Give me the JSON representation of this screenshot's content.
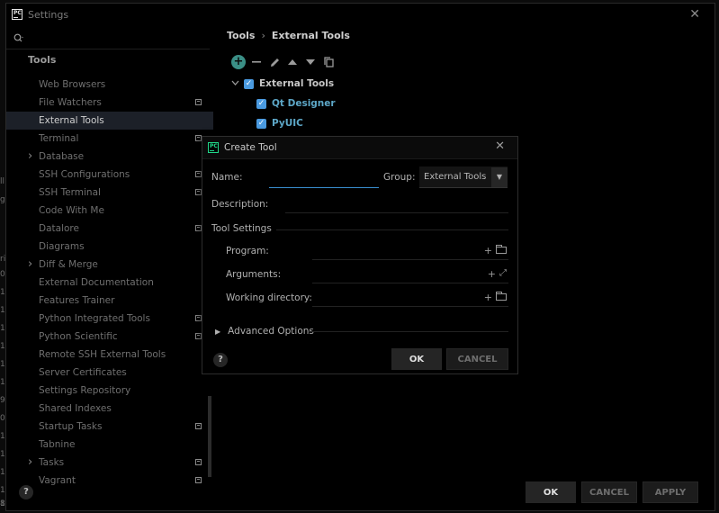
{
  "window": {
    "title": "Settings"
  },
  "sidebar": {
    "section": "Tools",
    "items": [
      {
        "label": "Web Browsers",
        "expandable": false,
        "project_icon": false,
        "selected": false
      },
      {
        "label": "File Watchers",
        "expandable": false,
        "project_icon": true,
        "selected": false
      },
      {
        "label": "External Tools",
        "expandable": false,
        "project_icon": false,
        "selected": true
      },
      {
        "label": "Terminal",
        "expandable": false,
        "project_icon": true,
        "selected": false
      },
      {
        "label": "Database",
        "expandable": true,
        "project_icon": false,
        "selected": false
      },
      {
        "label": "SSH Configurations",
        "expandable": false,
        "project_icon": true,
        "selected": false
      },
      {
        "label": "SSH Terminal",
        "expandable": false,
        "project_icon": true,
        "selected": false
      },
      {
        "label": "Code With Me",
        "expandable": false,
        "project_icon": false,
        "selected": false
      },
      {
        "label": "Datalore",
        "expandable": false,
        "project_icon": true,
        "selected": false
      },
      {
        "label": "Diagrams",
        "expandable": false,
        "project_icon": false,
        "selected": false
      },
      {
        "label": "Diff & Merge",
        "expandable": true,
        "project_icon": false,
        "selected": false
      },
      {
        "label": "External Documentation",
        "expandable": false,
        "project_icon": false,
        "selected": false
      },
      {
        "label": "Features Trainer",
        "expandable": false,
        "project_icon": false,
        "selected": false
      },
      {
        "label": "Python Integrated Tools",
        "expandable": false,
        "project_icon": true,
        "selected": false
      },
      {
        "label": "Python Scientific",
        "expandable": false,
        "project_icon": true,
        "selected": false
      },
      {
        "label": "Remote SSH External Tools",
        "expandable": false,
        "project_icon": false,
        "selected": false
      },
      {
        "label": "Server Certificates",
        "expandable": false,
        "project_icon": false,
        "selected": false
      },
      {
        "label": "Settings Repository",
        "expandable": false,
        "project_icon": false,
        "selected": false
      },
      {
        "label": "Shared Indexes",
        "expandable": false,
        "project_icon": false,
        "selected": false
      },
      {
        "label": "Startup Tasks",
        "expandable": false,
        "project_icon": true,
        "selected": false
      },
      {
        "label": "Tabnine",
        "expandable": false,
        "project_icon": false,
        "selected": false
      },
      {
        "label": "Tasks",
        "expandable": true,
        "project_icon": true,
        "selected": false
      },
      {
        "label": "Vagrant",
        "expandable": false,
        "project_icon": true,
        "selected": false
      }
    ],
    "help": "?"
  },
  "main": {
    "breadcrumb": [
      "Tools",
      "External Tools"
    ],
    "breadcrumb_sep": "›",
    "tree": {
      "group": "External Tools",
      "tools": [
        "Qt Designer",
        "PyUIC"
      ]
    }
  },
  "buttons": {
    "ok": "OK",
    "cancel": "CANCEL",
    "apply": "APPLY"
  },
  "dialog": {
    "title": "Create Tool",
    "name_label": "Name:",
    "name_value": "",
    "group_label": "Group:",
    "group_value": "External Tools",
    "description_label": "Description:",
    "tool_settings_label": "Tool Settings",
    "program_label": "Program:",
    "arguments_label": "Arguments:",
    "working_dir_label": "Working directory:",
    "advanced_label": "Advanced Options",
    "help": "?",
    "ok": "OK",
    "cancel": "CANCEL"
  },
  "left_edge_glyphs": [
    "ll",
    "g",
    "ri",
    "07",
    "11",
    "11",
    "11",
    "11",
    "11",
    "14",
    "9",
    "0",
    "11",
    "10",
    "1",
    "11",
    "11",
    "8"
  ],
  "colors": {
    "accent": "#3b8f86",
    "checkbox": "#4a9ae0",
    "focus": "#3a8fd0",
    "selected_bg": "#1c2028"
  }
}
